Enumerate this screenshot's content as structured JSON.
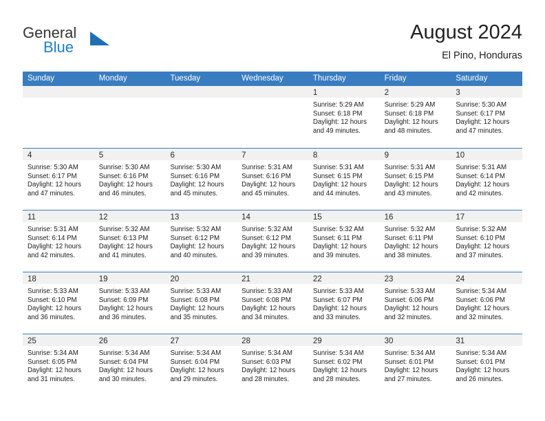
{
  "brand": {
    "name_part1": "General",
    "name_part2": "Blue",
    "flag_icon": "blue-triangle-flag-icon",
    "accent_color": "#1f7fc4"
  },
  "header": {
    "title": "August 2024",
    "subtitle": "El Pino, Honduras"
  },
  "colors": {
    "header_bar": "#3a7cc0",
    "day_band": "#f1f1f1",
    "row_divider": "#3a7cc0",
    "text": "#1b1b1b"
  },
  "weekdays": [
    "Sunday",
    "Monday",
    "Tuesday",
    "Wednesday",
    "Thursday",
    "Friday",
    "Saturday"
  ],
  "weeks": [
    [
      {
        "day": "",
        "sunrise": "",
        "sunset": "",
        "daylight_line1": "",
        "daylight_line2": ""
      },
      {
        "day": "",
        "sunrise": "",
        "sunset": "",
        "daylight_line1": "",
        "daylight_line2": ""
      },
      {
        "day": "",
        "sunrise": "",
        "sunset": "",
        "daylight_line1": "",
        "daylight_line2": ""
      },
      {
        "day": "",
        "sunrise": "",
        "sunset": "",
        "daylight_line1": "",
        "daylight_line2": ""
      },
      {
        "day": "1",
        "sunrise": "Sunrise: 5:29 AM",
        "sunset": "Sunset: 6:18 PM",
        "daylight_line1": "Daylight: 12 hours",
        "daylight_line2": "and 49 minutes."
      },
      {
        "day": "2",
        "sunrise": "Sunrise: 5:29 AM",
        "sunset": "Sunset: 6:18 PM",
        "daylight_line1": "Daylight: 12 hours",
        "daylight_line2": "and 48 minutes."
      },
      {
        "day": "3",
        "sunrise": "Sunrise: 5:30 AM",
        "sunset": "Sunset: 6:17 PM",
        "daylight_line1": "Daylight: 12 hours",
        "daylight_line2": "and 47 minutes."
      }
    ],
    [
      {
        "day": "4",
        "sunrise": "Sunrise: 5:30 AM",
        "sunset": "Sunset: 6:17 PM",
        "daylight_line1": "Daylight: 12 hours",
        "daylight_line2": "and 47 minutes."
      },
      {
        "day": "5",
        "sunrise": "Sunrise: 5:30 AM",
        "sunset": "Sunset: 6:16 PM",
        "daylight_line1": "Daylight: 12 hours",
        "daylight_line2": "and 46 minutes."
      },
      {
        "day": "6",
        "sunrise": "Sunrise: 5:30 AM",
        "sunset": "Sunset: 6:16 PM",
        "daylight_line1": "Daylight: 12 hours",
        "daylight_line2": "and 45 minutes."
      },
      {
        "day": "7",
        "sunrise": "Sunrise: 5:31 AM",
        "sunset": "Sunset: 6:16 PM",
        "daylight_line1": "Daylight: 12 hours",
        "daylight_line2": "and 45 minutes."
      },
      {
        "day": "8",
        "sunrise": "Sunrise: 5:31 AM",
        "sunset": "Sunset: 6:15 PM",
        "daylight_line1": "Daylight: 12 hours",
        "daylight_line2": "and 44 minutes."
      },
      {
        "day": "9",
        "sunrise": "Sunrise: 5:31 AM",
        "sunset": "Sunset: 6:15 PM",
        "daylight_line1": "Daylight: 12 hours",
        "daylight_line2": "and 43 minutes."
      },
      {
        "day": "10",
        "sunrise": "Sunrise: 5:31 AM",
        "sunset": "Sunset: 6:14 PM",
        "daylight_line1": "Daylight: 12 hours",
        "daylight_line2": "and 42 minutes."
      }
    ],
    [
      {
        "day": "11",
        "sunrise": "Sunrise: 5:31 AM",
        "sunset": "Sunset: 6:14 PM",
        "daylight_line1": "Daylight: 12 hours",
        "daylight_line2": "and 42 minutes."
      },
      {
        "day": "12",
        "sunrise": "Sunrise: 5:32 AM",
        "sunset": "Sunset: 6:13 PM",
        "daylight_line1": "Daylight: 12 hours",
        "daylight_line2": "and 41 minutes."
      },
      {
        "day": "13",
        "sunrise": "Sunrise: 5:32 AM",
        "sunset": "Sunset: 6:12 PM",
        "daylight_line1": "Daylight: 12 hours",
        "daylight_line2": "and 40 minutes."
      },
      {
        "day": "14",
        "sunrise": "Sunrise: 5:32 AM",
        "sunset": "Sunset: 6:12 PM",
        "daylight_line1": "Daylight: 12 hours",
        "daylight_line2": "and 39 minutes."
      },
      {
        "day": "15",
        "sunrise": "Sunrise: 5:32 AM",
        "sunset": "Sunset: 6:11 PM",
        "daylight_line1": "Daylight: 12 hours",
        "daylight_line2": "and 39 minutes."
      },
      {
        "day": "16",
        "sunrise": "Sunrise: 5:32 AM",
        "sunset": "Sunset: 6:11 PM",
        "daylight_line1": "Daylight: 12 hours",
        "daylight_line2": "and 38 minutes."
      },
      {
        "day": "17",
        "sunrise": "Sunrise: 5:32 AM",
        "sunset": "Sunset: 6:10 PM",
        "daylight_line1": "Daylight: 12 hours",
        "daylight_line2": "and 37 minutes."
      }
    ],
    [
      {
        "day": "18",
        "sunrise": "Sunrise: 5:33 AM",
        "sunset": "Sunset: 6:10 PM",
        "daylight_line1": "Daylight: 12 hours",
        "daylight_line2": "and 36 minutes."
      },
      {
        "day": "19",
        "sunrise": "Sunrise: 5:33 AM",
        "sunset": "Sunset: 6:09 PM",
        "daylight_line1": "Daylight: 12 hours",
        "daylight_line2": "and 36 minutes."
      },
      {
        "day": "20",
        "sunrise": "Sunrise: 5:33 AM",
        "sunset": "Sunset: 6:08 PM",
        "daylight_line1": "Daylight: 12 hours",
        "daylight_line2": "and 35 minutes."
      },
      {
        "day": "21",
        "sunrise": "Sunrise: 5:33 AM",
        "sunset": "Sunset: 6:08 PM",
        "daylight_line1": "Daylight: 12 hours",
        "daylight_line2": "and 34 minutes."
      },
      {
        "day": "22",
        "sunrise": "Sunrise: 5:33 AM",
        "sunset": "Sunset: 6:07 PM",
        "daylight_line1": "Daylight: 12 hours",
        "daylight_line2": "and 33 minutes."
      },
      {
        "day": "23",
        "sunrise": "Sunrise: 5:33 AM",
        "sunset": "Sunset: 6:06 PM",
        "daylight_line1": "Daylight: 12 hours",
        "daylight_line2": "and 32 minutes."
      },
      {
        "day": "24",
        "sunrise": "Sunrise: 5:34 AM",
        "sunset": "Sunset: 6:06 PM",
        "daylight_line1": "Daylight: 12 hours",
        "daylight_line2": "and 32 minutes."
      }
    ],
    [
      {
        "day": "25",
        "sunrise": "Sunrise: 5:34 AM",
        "sunset": "Sunset: 6:05 PM",
        "daylight_line1": "Daylight: 12 hours",
        "daylight_line2": "and 31 minutes."
      },
      {
        "day": "26",
        "sunrise": "Sunrise: 5:34 AM",
        "sunset": "Sunset: 6:04 PM",
        "daylight_line1": "Daylight: 12 hours",
        "daylight_line2": "and 30 minutes."
      },
      {
        "day": "27",
        "sunrise": "Sunrise: 5:34 AM",
        "sunset": "Sunset: 6:04 PM",
        "daylight_line1": "Daylight: 12 hours",
        "daylight_line2": "and 29 minutes."
      },
      {
        "day": "28",
        "sunrise": "Sunrise: 5:34 AM",
        "sunset": "Sunset: 6:03 PM",
        "daylight_line1": "Daylight: 12 hours",
        "daylight_line2": "and 28 minutes."
      },
      {
        "day": "29",
        "sunrise": "Sunrise: 5:34 AM",
        "sunset": "Sunset: 6:02 PM",
        "daylight_line1": "Daylight: 12 hours",
        "daylight_line2": "and 28 minutes."
      },
      {
        "day": "30",
        "sunrise": "Sunrise: 5:34 AM",
        "sunset": "Sunset: 6:01 PM",
        "daylight_line1": "Daylight: 12 hours",
        "daylight_line2": "and 27 minutes."
      },
      {
        "day": "31",
        "sunrise": "Sunrise: 5:34 AM",
        "sunset": "Sunset: 6:01 PM",
        "daylight_line1": "Daylight: 12 hours",
        "daylight_line2": "and 26 minutes."
      }
    ]
  ]
}
